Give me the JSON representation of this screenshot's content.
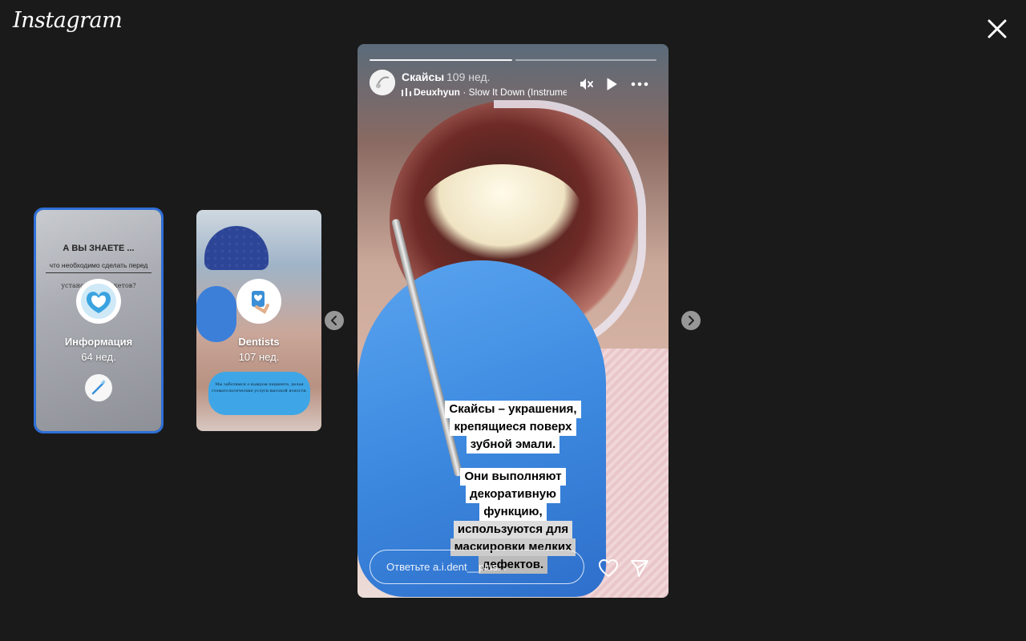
{
  "app": {
    "logo_text": "Instagram"
  },
  "previews": [
    {
      "name": "Информация",
      "age": "64 нед.",
      "headline": "А ВЫ ЗНАЕТЕ ...",
      "subline": "что необходимо сделать перед",
      "third_line": "установкой брекетов?"
    },
    {
      "name": "Dentists",
      "age": "107 нед.",
      "bubble_text": "Мы заботимся о каждом пациенте, делая стоматологические услуги высокой ясности."
    }
  ],
  "story": {
    "username": "Скайсы",
    "age": "109 нед.",
    "music_artist": "Deuxhyun",
    "music_track": " · Slow It Down (Instrumental)",
    "progress_segments": 2,
    "progress_done": 1,
    "caption_top": [
      "Скайсы – украшения,",
      "крепящиеся поверх",
      "зубной эмали."
    ],
    "caption_bottom": [
      "Они выполняют",
      "декоративную",
      "функцию,",
      "используются для",
      "маскировки мелких",
      "дефектов."
    ],
    "reply_placeholder": "Ответьте a.i.dent__plus..."
  },
  "icons": {
    "close": "close-icon",
    "mute": "speaker-muted-icon",
    "play": "play-icon",
    "more": "more-horizontal-icon",
    "like": "heart-icon",
    "share": "send-icon",
    "prev": "chevron-left-icon",
    "next": "chevron-right-icon"
  }
}
